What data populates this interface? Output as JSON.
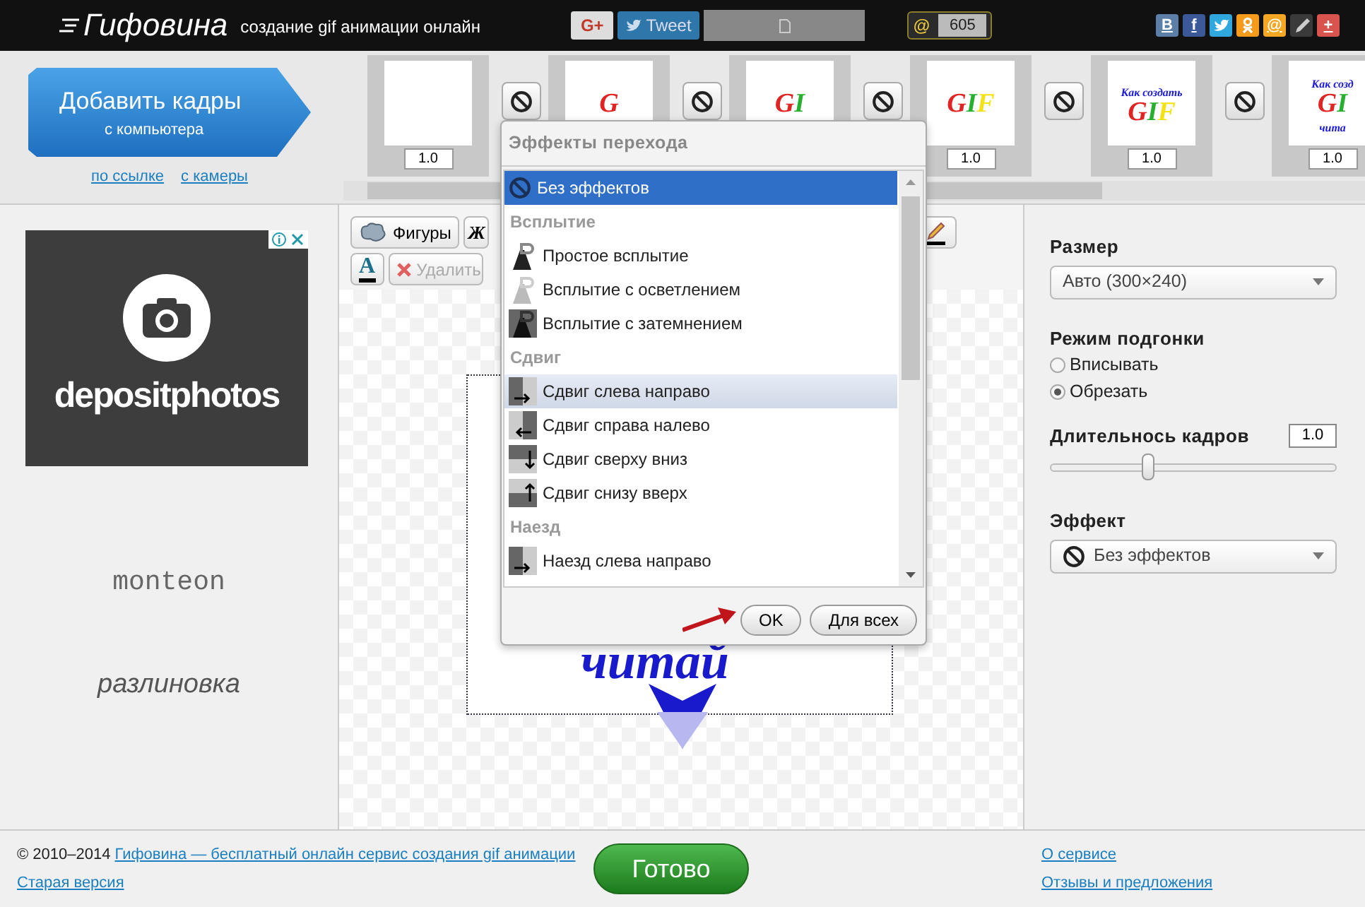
{
  "header": {
    "logo": "Гифовина",
    "tagline": "создание gif анимации онлайн",
    "share": [
      {
        "kind": "gplus",
        "label": "G+"
      },
      {
        "kind": "tweet",
        "label": "Tweet"
      },
      {
        "kind": "blank"
      }
    ],
    "counter": {
      "icon": "@",
      "value": "605"
    },
    "socials": [
      {
        "kind": "text",
        "label": "B",
        "color": "#5b7fa6"
      },
      {
        "kind": "text",
        "label": "f",
        "color": "#3b5998"
      },
      {
        "kind": "bird",
        "color": "#2fa7df"
      },
      {
        "kind": "ok",
        "color": "#f59a1b"
      },
      {
        "kind": "text",
        "label": "@",
        "color": "#f5a623"
      },
      {
        "kind": "pencil",
        "color": "#3a3a3a"
      },
      {
        "kind": "text",
        "label": "+",
        "color": "#d9534f"
      }
    ]
  },
  "add": {
    "title": "Добавить кадры",
    "subtitle": "с компьютера",
    "links": [
      "по ссылке",
      "с камеры"
    ]
  },
  "frames": [
    {
      "duration": "1.0"
    },
    {
      "lines": [
        [
          {
            "text": "G",
            "color": "#e02424"
          }
        ]
      ]
    },
    {
      "lines": [
        [
          {
            "text": "G",
            "color": "#e02424"
          },
          {
            "text": "I",
            "color": "#27b030"
          }
        ]
      ]
    },
    {
      "duration": "1.0",
      "lines": [
        [
          {
            "text": "G",
            "color": "#e02424"
          },
          {
            "text": "I",
            "color": "#27b030"
          },
          {
            "text": "F",
            "color": "#f2e316"
          }
        ]
      ]
    },
    {
      "duration": "1.0",
      "lines": [
        [
          {
            "text": "Как создать",
            "color": "#1a1adb"
          }
        ],
        [
          {
            "text": "G",
            "color": "#e02424"
          },
          {
            "text": "I",
            "color": "#27b030"
          },
          {
            "text": "F",
            "color": "#f2e316"
          }
        ]
      ]
    },
    {
      "duration": "1.0",
      "lines": [
        [
          {
            "text": "Как созд",
            "color": "#1a1adb"
          }
        ],
        [
          {
            "text": "G",
            "color": "#e02424"
          },
          {
            "text": "I",
            "color": "#27b030"
          }
        ],
        [
          {
            "text": "чита",
            "color": "#1a1adb"
          }
        ]
      ]
    }
  ],
  "transitions": [
    {
      "kind": "none"
    },
    {
      "kind": "none"
    },
    {
      "kind": "none"
    },
    {
      "kind": "none"
    },
    {
      "kind": "none"
    }
  ],
  "ad": {
    "brand": "depositphotos"
  },
  "side_texts": [
    {
      "kind": "mono",
      "text": "monteon"
    },
    {
      "kind": "italic",
      "text": "разлиновка"
    }
  ],
  "toolbar": [
    {
      "kind": "shapes",
      "label": "Фигуры",
      "disabled": false
    },
    {
      "kind": "bold",
      "label": "Ж",
      "disabled": false
    },
    {
      "kind": "pencil"
    },
    {
      "kind": "textcolor",
      "label": "A"
    },
    {
      "kind": "delete",
      "label": "Удалить",
      "disabled": true
    }
  ],
  "canvas": {
    "text": "читай"
  },
  "popup": {
    "title": "Эффекты перехода",
    "items": [
      {
        "kind": "none",
        "label": "Без эффектов",
        "selected": true,
        "hovered": false
      },
      {
        "kind": "group",
        "label": "Всплытие"
      },
      {
        "kind": "rise",
        "label": "Простое всплытие",
        "selected": false,
        "hovered": false
      },
      {
        "kind": "rise_light",
        "label": "Всплытие с осветлением",
        "selected": false,
        "hovered": false
      },
      {
        "kind": "rise_dark",
        "label": "Всплытие с затемнением",
        "selected": false,
        "hovered": false
      },
      {
        "kind": "group",
        "label": "Сдвиг"
      },
      {
        "kind": "slide_right",
        "label": "Сдвиг слева направо",
        "selected": false,
        "hovered": true
      },
      {
        "kind": "slide_left",
        "label": "Сдвиг справа налево",
        "selected": false,
        "hovered": false
      },
      {
        "kind": "slide_down",
        "label": "Сдвиг сверху вниз",
        "selected": false,
        "hovered": false
      },
      {
        "kind": "slide_up",
        "label": "Сдвиг снизу вверх",
        "selected": false,
        "hovered": false
      },
      {
        "kind": "group",
        "label": "Наезд"
      },
      {
        "kind": "slide_right",
        "label": "Наезд слева направо",
        "selected": false,
        "hovered": false
      }
    ],
    "buttons": [
      "OK",
      "Для всех"
    ]
  },
  "settings": {
    "size": {
      "label": "Размер",
      "value": "Авто (300×240)"
    },
    "fit": {
      "label": "Режим подгонки",
      "options": [
        {
          "label": "Вписывать",
          "selected": false
        },
        {
          "label": "Обрезать",
          "selected": true
        }
      ]
    },
    "duration": {
      "label": "Длительнось кадров",
      "value": "1.0",
      "level": 0.34
    },
    "effect": {
      "label": "Эффект",
      "value": "Без эффектов"
    }
  },
  "footer": {
    "copyright": "© 2010–2014",
    "site_link": "Гифовина — бесплатный онлайн сервис создания gif анимации",
    "old_link": "Старая версия",
    "done": "Готово",
    "links": [
      "О сервисе",
      "Отзывы и предложения"
    ]
  }
}
